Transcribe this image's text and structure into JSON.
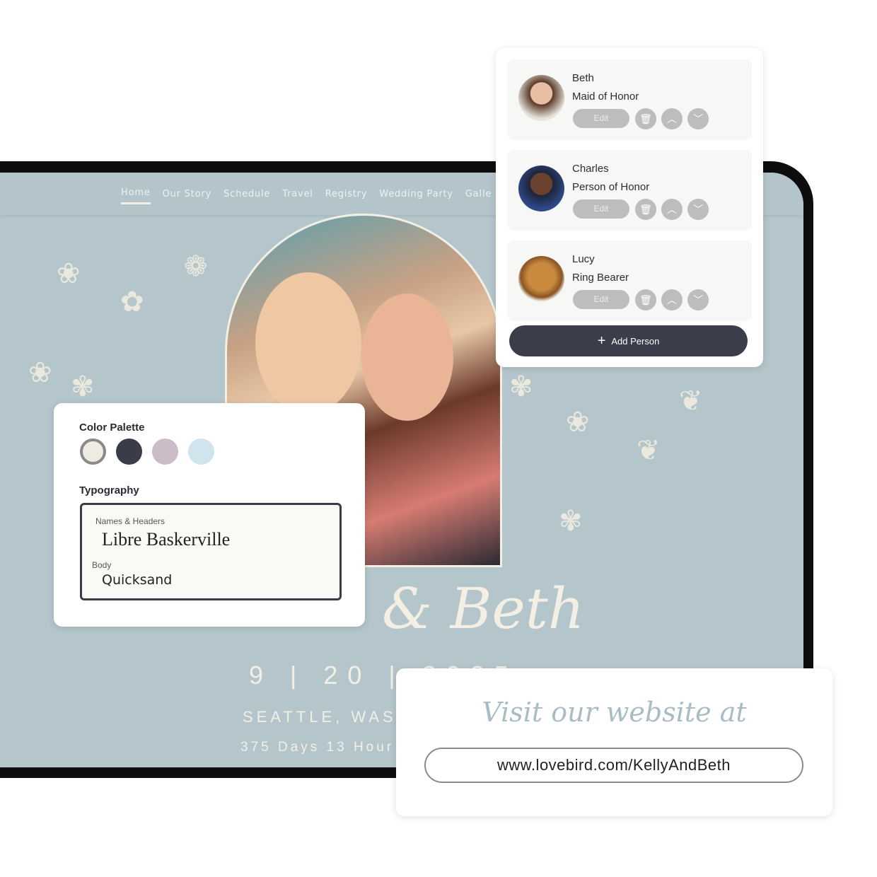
{
  "site": {
    "nav": [
      "Home",
      "Our Story",
      "Schedule",
      "Travel",
      "Registry",
      "Wedding Party",
      "Galle"
    ],
    "title": "& Beth",
    "date": "9 | 20 | 2025",
    "location": "SEATTLE, WASH",
    "countdown": "375 Days  13 Hour"
  },
  "palette_card": {
    "color_label": "Color Palette",
    "colors": [
      "#eeebe3",
      "#3b3c4a",
      "#cbbcc8",
      "#cfe4ec"
    ],
    "typography_label": "Typography",
    "headers_label": "Names & Headers",
    "headers_font": "Libre Baskerville",
    "body_label": "Body",
    "body_font": "Quicksand"
  },
  "people": [
    {
      "name": "Beth",
      "role": "Maid of Honor",
      "edit": "Edit"
    },
    {
      "name": "Charles",
      "role": "Person of Honor",
      "edit": "Edit"
    },
    {
      "name": "Lucy",
      "role": "Ring Bearer",
      "edit": "Edit"
    }
  ],
  "add_person": "Add Person",
  "url_card": {
    "visit": "Visit our website at",
    "url": "www.lovebird.com/KellyAndBeth"
  }
}
